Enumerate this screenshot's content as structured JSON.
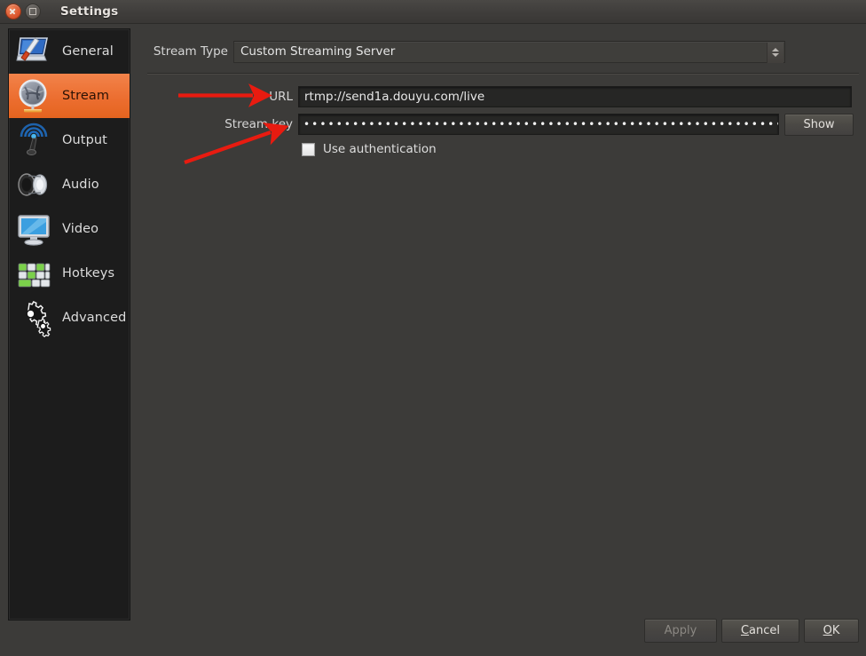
{
  "window": {
    "title": "Settings",
    "close_icon": "close-icon",
    "maximize_icon": "maximize-icon"
  },
  "sidebar": {
    "items": [
      {
        "label": "General",
        "icon": "general-icon",
        "selected": false
      },
      {
        "label": "Stream",
        "icon": "stream-icon",
        "selected": true
      },
      {
        "label": "Output",
        "icon": "output-icon",
        "selected": false
      },
      {
        "label": "Audio",
        "icon": "audio-icon",
        "selected": false
      },
      {
        "label": "Video",
        "icon": "video-icon",
        "selected": false
      },
      {
        "label": "Hotkeys",
        "icon": "hotkeys-icon",
        "selected": false
      },
      {
        "label": "Advanced",
        "icon": "advanced-icon",
        "selected": false
      }
    ]
  },
  "stream": {
    "stream_type_label": "Stream Type",
    "stream_type_value": "Custom Streaming Server",
    "url_label": "URL",
    "url_value": "rtmp://send1a.douyu.com/live",
    "stream_key_label": "Stream key",
    "stream_key_masked": "•••••••••••••••••••••••••••••••••••••••••••••••••••••••••••••••••••••••••••••••••••",
    "show_button": "Show",
    "use_auth_label": "Use authentication",
    "use_auth_checked": false
  },
  "footer": {
    "apply": "Apply",
    "apply_disabled": true,
    "cancel_pre": "C",
    "cancel_rest": "ancel",
    "ok_pre": "O",
    "ok_rest": "K"
  },
  "annotations": {
    "arrow_color": "#e81b10",
    "arrow_url_target": "URL",
    "arrow_streamkey_target": "Stream key"
  },
  "colors": {
    "accent": "#ec6e30",
    "window_bg": "#3c3b39",
    "sidebar_bg": "#1c1c1c",
    "field_bg": "#262625",
    "text": "#e6e6e6"
  }
}
